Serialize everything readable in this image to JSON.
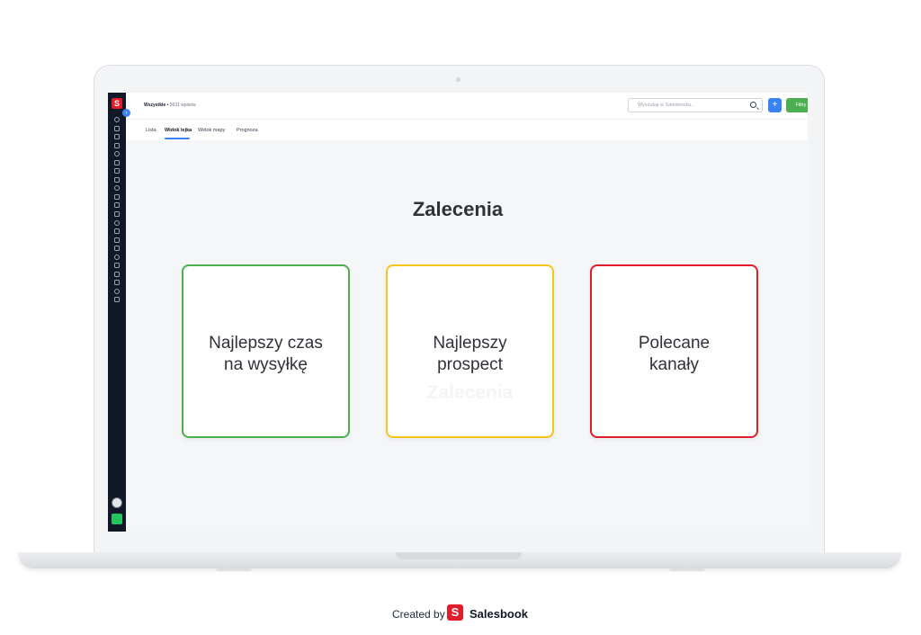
{
  "header": {
    "breadcrumb_bold": "Wszystkie",
    "breadcrumb_sep": " • ",
    "breadcrumb_count": "5631 wpisów",
    "search_placeholder": "Wyszukaj w Salesbooku...",
    "add_label": "+",
    "filter_label": "Filtry ⌄"
  },
  "tabs": [
    {
      "label": "Lista",
      "active": false
    },
    {
      "label": "Widok lejka",
      "active": true
    },
    {
      "label": "Widok mapy",
      "active": false
    },
    {
      "label": "Prognoza",
      "active": false
    }
  ],
  "main": {
    "title": "Zalecenia",
    "cards": [
      {
        "label": "Najlepszy czas na wysyłkę",
        "line1": "Najlepszy czas",
        "line2": "na wysyłkę",
        "color": "#4caf50"
      },
      {
        "label": "Najlepszy prospect",
        "line1": "Najlepszy",
        "line2": "prospect",
        "color": "#f5c518"
      },
      {
        "label": "Polecane kanały",
        "line1": "Polecane",
        "line2": "kanały",
        "color": "#e11d2a"
      }
    ],
    "ghost_text": "Zalecenia"
  },
  "sidebar": {
    "logo": "S",
    "collapse": "›",
    "icons": [
      "dashboard-icon",
      "chart-icon",
      "monitor-icon",
      "document-icon",
      "inbox-icon",
      "notes-icon",
      "clipboard-icon",
      "calendar-icon",
      "folder-icon",
      "contacts-icon",
      "gift-icon",
      "grid-icon",
      "stack-icon",
      "send-icon",
      "link-icon",
      "mail-icon",
      "archive-icon",
      "bell-icon",
      "calculator-icon",
      "team-icon",
      "car-icon",
      "settings-icon"
    ]
  },
  "credit": {
    "prefix": "Created by",
    "logo": "S",
    "brand": "Salesbook"
  },
  "colors": {
    "brand_red": "#e11d2a",
    "accent_blue": "#3b82f6",
    "filter_green": "#4caf50",
    "sidebar_bg": "#111827"
  }
}
